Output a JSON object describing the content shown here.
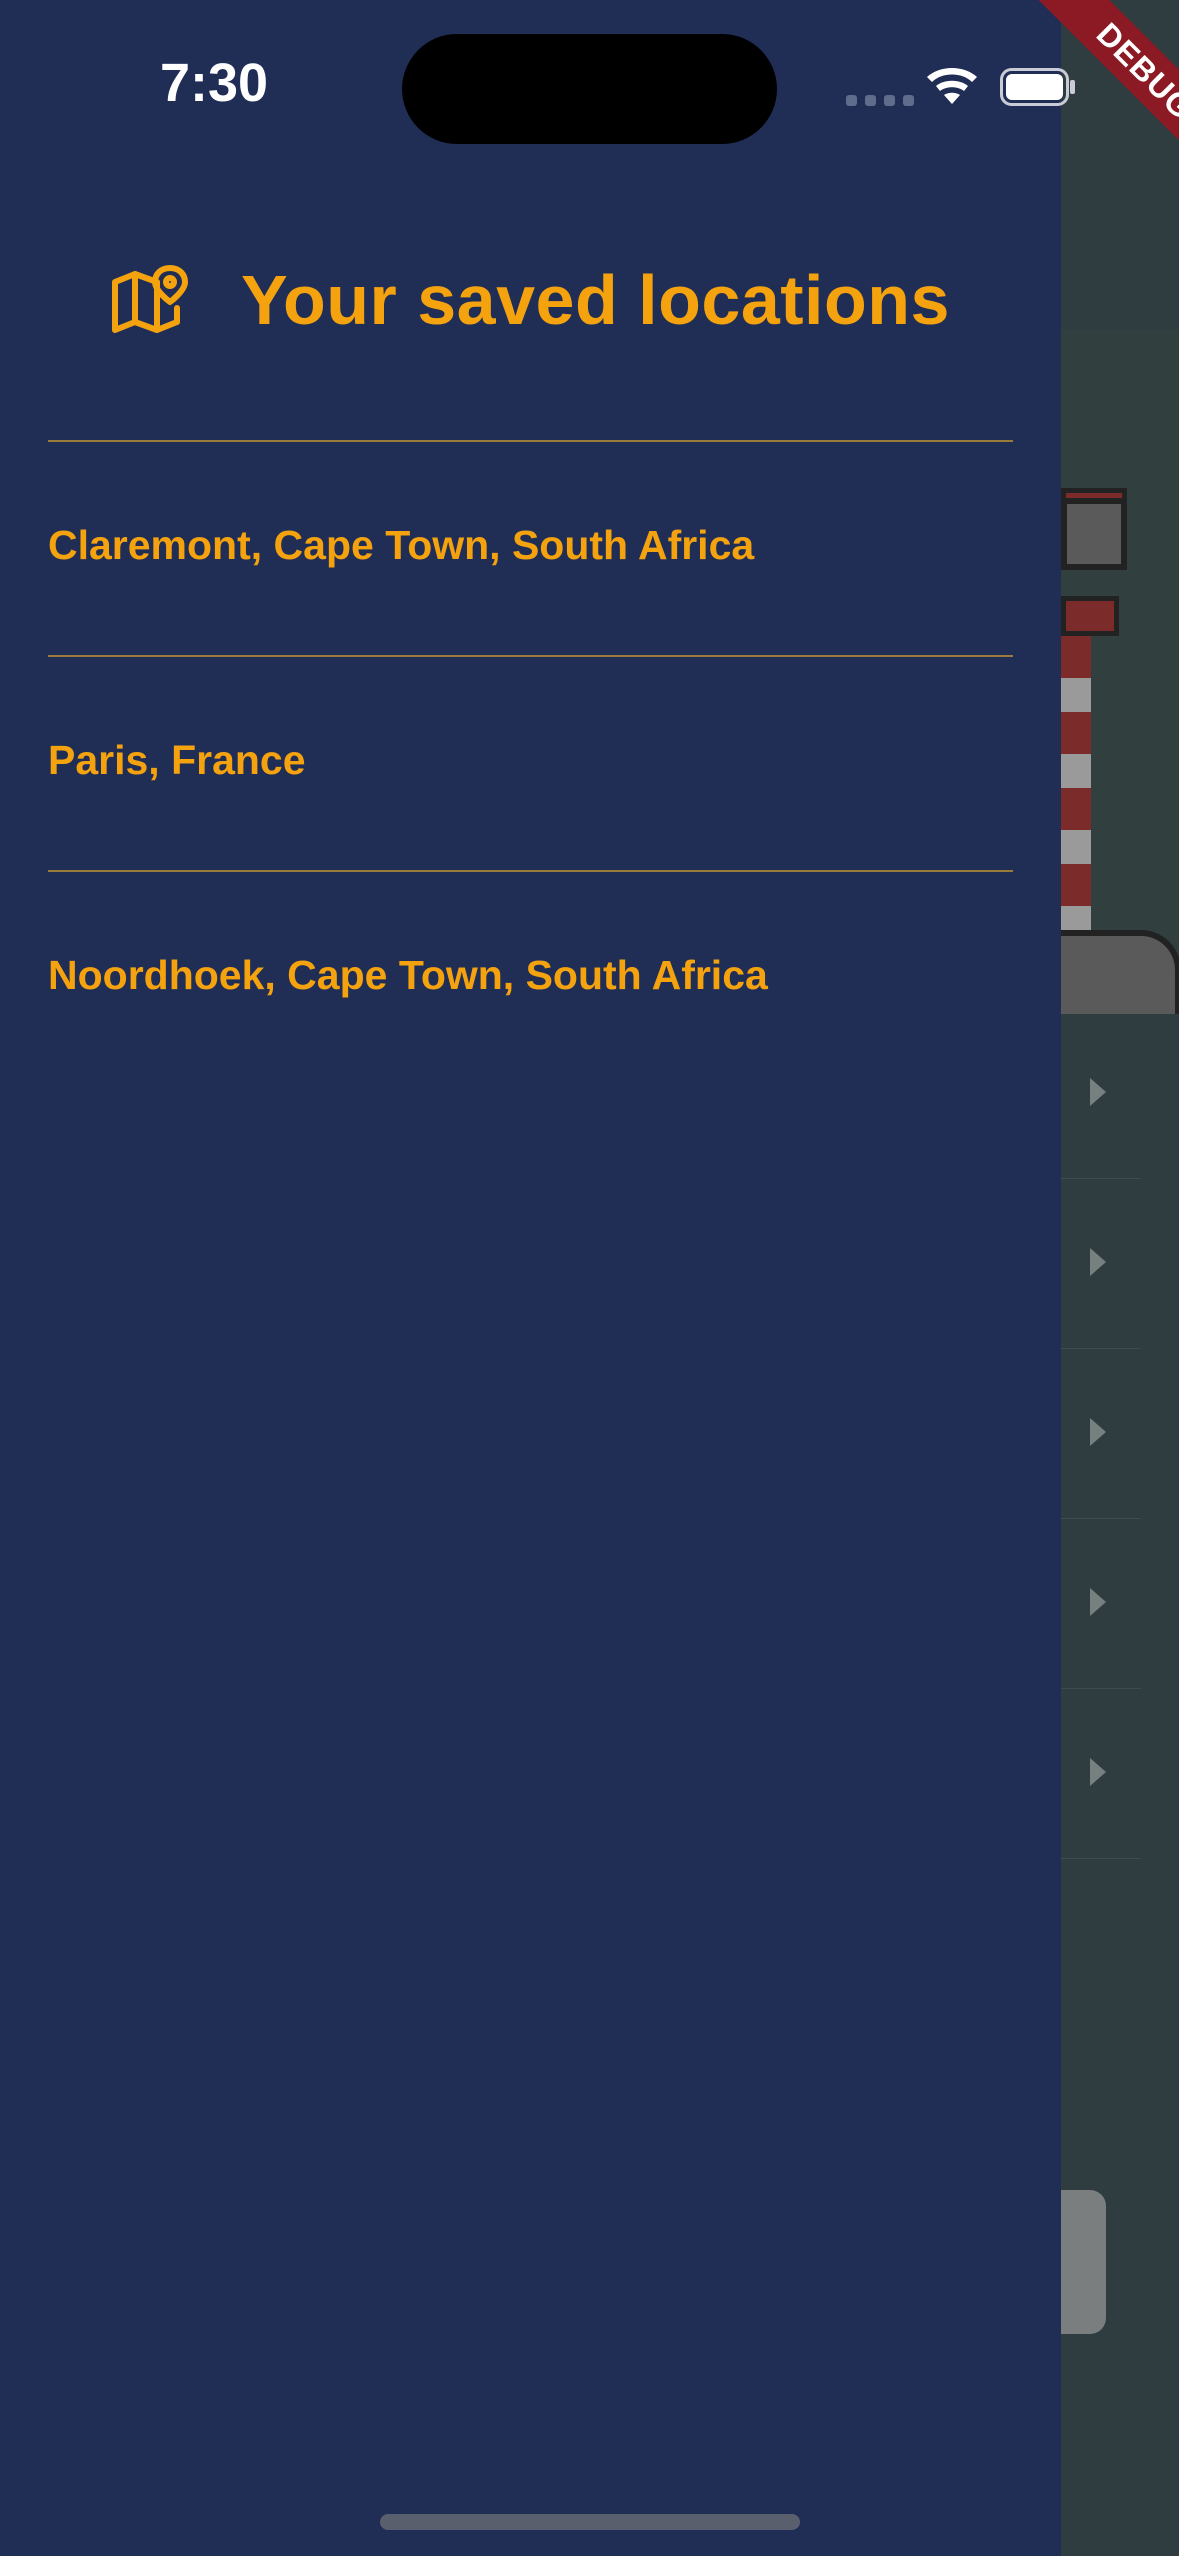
{
  "status_bar": {
    "time": "7:30"
  },
  "debug_banner": {
    "label": "DEBUG"
  },
  "drawer": {
    "title": "Your saved locations",
    "icon": "map-pin-icon",
    "locations": [
      {
        "label": "Claremont, Cape Town, South Africa"
      },
      {
        "label": "Paris, France"
      },
      {
        "label": "Noordhoek, Cape Town, South Africa"
      }
    ]
  },
  "colors": {
    "drawer_background": "#202e56",
    "accent": "#f5a20f",
    "divider": "#9a7c3a",
    "backdrop": "#2f3d41",
    "debug_ribbon": "#8b1a24"
  }
}
